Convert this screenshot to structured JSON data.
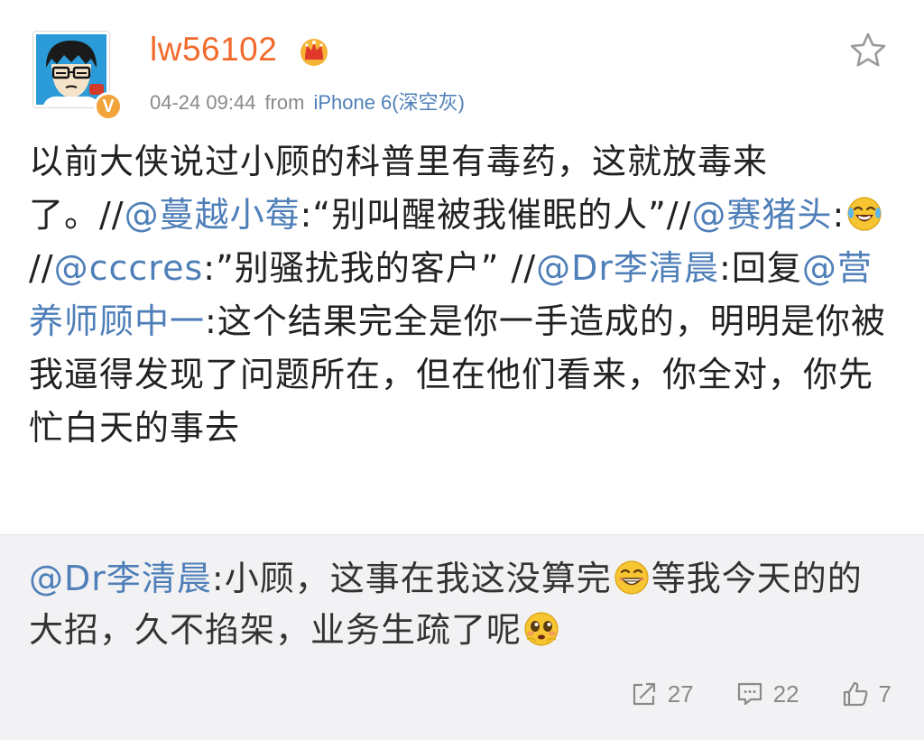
{
  "author": {
    "username": "lw56102",
    "verified_badge": "V",
    "vip_icon": "crown-icon"
  },
  "meta": {
    "timestamp": "04-24 09:44",
    "from_label": "from",
    "source": "iPhone 6(深空灰)"
  },
  "post": {
    "seg1": "以前大侠说过小顾的科普里有毒药，这就放毒来了。//",
    "mention1": "@蔓越小莓",
    "seg2": ":“别叫醒被我催眠的人”//",
    "mention2": "@赛猪头",
    "seg3": ":",
    "emoji1": "laughing-tears-emoji",
    "seg4": " //",
    "mention3": "@cccres",
    "seg5": ":”别骚扰我的客户” //",
    "mention4": "@Dr李清晨",
    "seg6": ":回复",
    "mention5": "@营养师顾中一",
    "seg7": ":这个结果完全是你一手造成的，明明是你被我逼得发现了问题所在，但在他们看来，你全对，你先忙白天的事去"
  },
  "repost": {
    "mention": "@Dr李清晨",
    "seg1": ":小顾，这事在我这没算完",
    "emoji1": "grin-emoji",
    "seg2": "等我今天的的大招，久不掐架，业务生疏了呢",
    "emoji2": "pleading-emoji"
  },
  "actions": {
    "repost_count": "27",
    "comment_count": "22",
    "like_count": "7"
  },
  "colors": {
    "username": "#f16a2b",
    "link": "#4f7fb8",
    "repost_bg": "#f2f2f4",
    "badge": "#f2a33a"
  }
}
